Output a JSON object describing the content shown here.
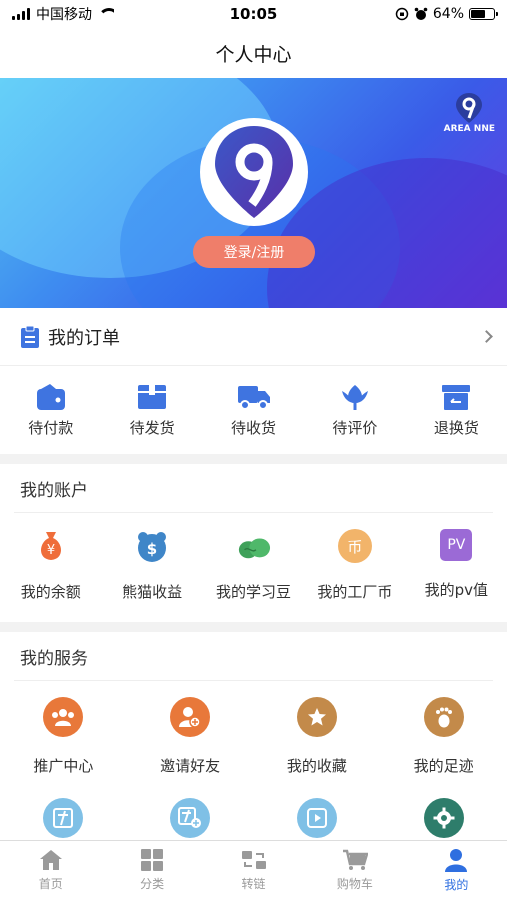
{
  "status": {
    "carrier": "中国移动",
    "time": "10:05",
    "battery": "64%",
    "battery_level": 0.64
  },
  "nav": {
    "title": "个人中心"
  },
  "hero": {
    "login_label": "登录/注册",
    "brand_text": "AREA NNE"
  },
  "orders": {
    "title": "我的订单",
    "items": [
      {
        "label": "待付款",
        "icon": "wallet-icon"
      },
      {
        "label": "待发货",
        "icon": "box-icon"
      },
      {
        "label": "待收货",
        "icon": "truck-icon"
      },
      {
        "label": "待评价",
        "icon": "flower-icon"
      },
      {
        "label": "退换货",
        "icon": "return-box-icon"
      }
    ]
  },
  "account": {
    "title": "我的账户",
    "items": [
      {
        "label": "我的余额",
        "icon": "money-bag-icon",
        "glyph": "¥",
        "color": "#ef6d3a"
      },
      {
        "label": "熊猫收益",
        "icon": "panda-dollar-icon",
        "glyph": "$",
        "color": "#3f86c8"
      },
      {
        "label": "我的学习豆",
        "icon": "beans-icon",
        "glyph": "",
        "color": "#3fa15a"
      },
      {
        "label": "我的工厂币",
        "icon": "coin-icon",
        "glyph": "币",
        "color": "#f2b46a"
      },
      {
        "label": "我的pv值",
        "icon": "pv-icon",
        "glyph": "PV",
        "color": "#9b6ad6"
      }
    ]
  },
  "services": {
    "title": "我的服务",
    "items": [
      {
        "label": "推广中心",
        "icon": "group-icon",
        "color": "#e8783a"
      },
      {
        "label": "邀请好友",
        "icon": "add-user-icon",
        "color": "#e8783a"
      },
      {
        "label": "我的收藏",
        "icon": "star-icon",
        "color": "#c38a4a"
      },
      {
        "label": "我的足迹",
        "icon": "footprint-icon",
        "color": "#c38a4a"
      }
    ],
    "row2": [
      {
        "icon": "talent-icon",
        "color": "#7fc0e6"
      },
      {
        "icon": "add-talent-icon",
        "color": "#7fc0e6"
      },
      {
        "icon": "play-icon",
        "color": "#7fc0e6"
      },
      {
        "icon": "settings-icon",
        "color": "#2e7d6b"
      }
    ]
  },
  "tabs": [
    {
      "label": "首页",
      "icon": "home-icon",
      "active": false
    },
    {
      "label": "分类",
      "icon": "grid-icon",
      "active": false
    },
    {
      "label": "转链",
      "icon": "transfer-icon",
      "active": false
    },
    {
      "label": "购物车",
      "icon": "cart-icon",
      "active": false
    },
    {
      "label": "我的",
      "icon": "user-icon",
      "active": true
    }
  ]
}
